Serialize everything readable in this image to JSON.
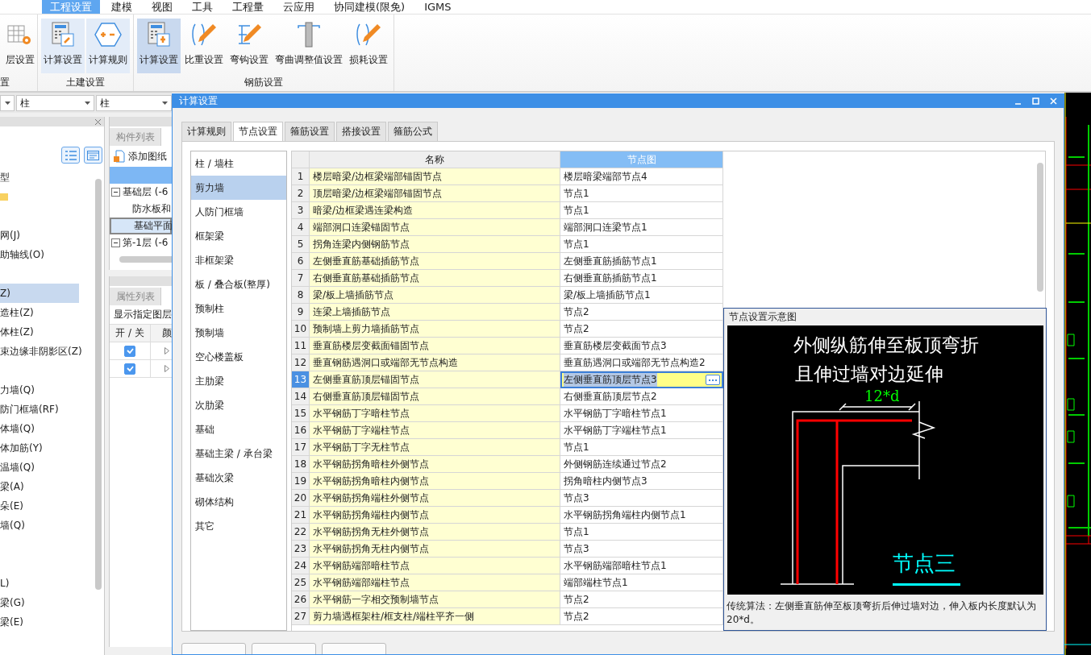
{
  "menu": [
    {
      "label": "工程设置",
      "selected": true
    },
    {
      "label": "建模",
      "selected": false
    },
    {
      "label": "视图",
      "selected": false
    },
    {
      "label": "工具",
      "selected": false
    },
    {
      "label": "工程量",
      "selected": false
    },
    {
      "label": "云应用",
      "selected": false
    },
    {
      "label": "协同建模(限免)",
      "selected": false
    },
    {
      "label": "IGMS",
      "selected": false
    }
  ],
  "ribbon": {
    "groups": [
      {
        "label": "置",
        "buttons": [
          {
            "label": "层设置",
            "selected": false,
            "highlighted": false
          }
        ]
      },
      {
        "label": "土建设置",
        "buttons": [
          {
            "label": "计算设置",
            "selected": false,
            "highlighted": true
          },
          {
            "label": "计算规则",
            "selected": false,
            "highlighted": true
          }
        ]
      },
      {
        "label": "钢筋设置",
        "buttons": [
          {
            "label": "计算设置",
            "selected": true,
            "highlighted": false
          },
          {
            "label": "比重设置",
            "selected": false,
            "highlighted": false
          },
          {
            "label": "弯钩设置",
            "selected": false,
            "highlighted": false
          },
          {
            "label": "弯曲调整值设置",
            "selected": false,
            "highlighted": false
          },
          {
            "label": "损耗设置",
            "selected": false,
            "highlighted": false
          }
        ]
      }
    ]
  },
  "selectors": [
    {
      "value": "柱"
    },
    {
      "value": "柱"
    }
  ],
  "left_panel": {
    "items": [
      {
        "kind": "item",
        "label": "型",
        "selected": false
      },
      {
        "kind": "tag",
        "selected": false
      },
      {
        "kind": "blank",
        "selected": false
      },
      {
        "kind": "item",
        "label": "网(J)",
        "selected": false
      },
      {
        "kind": "item",
        "label": "助轴线(O)",
        "selected": false
      },
      {
        "kind": "blank",
        "selected": false
      },
      {
        "kind": "item",
        "label": "Z)",
        "selected": true
      },
      {
        "kind": "item",
        "label": "造柱(Z)",
        "selected": false
      },
      {
        "kind": "item",
        "label": "体柱(Z)",
        "selected": false
      },
      {
        "kind": "item",
        "label": "束边缘非阴影区(Z)",
        "selected": false
      },
      {
        "kind": "blank",
        "selected": false
      },
      {
        "kind": "item",
        "label": "力墙(Q)",
        "selected": false
      },
      {
        "kind": "item",
        "label": "防门框墙(RF)",
        "selected": false
      },
      {
        "kind": "item",
        "label": "体墙(Q)",
        "selected": false
      },
      {
        "kind": "item",
        "label": "体加筋(Y)",
        "selected": false
      },
      {
        "kind": "item",
        "label": "温墙(Q)",
        "selected": false
      },
      {
        "kind": "item",
        "label": "梁(A)",
        "selected": false
      },
      {
        "kind": "item",
        "label": "朵(E)",
        "selected": false
      },
      {
        "kind": "item",
        "label": "墙(Q)",
        "selected": false
      },
      {
        "kind": "blank",
        "selected": false
      },
      {
        "kind": "blank",
        "selected": false
      },
      {
        "kind": "item",
        "label": "L)",
        "selected": false
      },
      {
        "kind": "item",
        "label": "梁(G)",
        "selected": false
      },
      {
        "kind": "item",
        "label": "梁(E)",
        "selected": false
      }
    ]
  },
  "component_panel": {
    "tab": "构件列表",
    "action": "添加图纸",
    "tree": [
      {
        "label": "基础层 (-6",
        "expanded": true,
        "selected": false,
        "children": [
          {
            "label": "防水板和",
            "selected": false
          },
          {
            "label": "基础平面",
            "selected": true
          }
        ]
      },
      {
        "label": "第-1层 (-6",
        "expanded": true,
        "selected": false
      }
    ]
  },
  "property_panel": {
    "tab": "属性列表",
    "filter": "显示指定图层",
    "columns": [
      "开 / 关",
      "颜"
    ],
    "rows": [
      {
        "checked": true
      },
      {
        "checked": true
      }
    ]
  },
  "dialog": {
    "title": "计算设置",
    "tabs": [
      {
        "label": "计算规则",
        "selected": false
      },
      {
        "label": "节点设置",
        "selected": true
      },
      {
        "label": "箍筋设置",
        "selected": false
      },
      {
        "label": "搭接设置",
        "selected": false
      },
      {
        "label": "箍筋公式",
        "selected": false
      }
    ],
    "categories": [
      {
        "label": "柱 / 墙柱",
        "selected": false
      },
      {
        "label": "剪力墙",
        "selected": true
      },
      {
        "label": "人防门框墙",
        "selected": false
      },
      {
        "label": "框架梁",
        "selected": false
      },
      {
        "label": "非框架梁",
        "selected": false
      },
      {
        "label": "板 / 叠合板(整厚)",
        "selected": false
      },
      {
        "label": "预制柱",
        "selected": false
      },
      {
        "label": "预制墙",
        "selected": false
      },
      {
        "label": "空心楼盖板",
        "selected": false
      },
      {
        "label": "主肋梁",
        "selected": false
      },
      {
        "label": "次肋梁",
        "selected": false
      },
      {
        "label": "基础",
        "selected": false
      },
      {
        "label": "基础主梁 / 承台梁",
        "selected": false
      },
      {
        "label": "基础次梁",
        "selected": false
      },
      {
        "label": "砌体结构",
        "selected": false
      },
      {
        "label": "其它",
        "selected": false
      }
    ],
    "table": {
      "columns": [
        {
          "label": "名称",
          "selected": false
        },
        {
          "label": "节点图",
          "selected": true
        }
      ],
      "rows": [
        {
          "index": "1",
          "name": "楼层暗梁/边框梁端部锚固节点",
          "node": "楼层暗梁端部节点4",
          "selected": false
        },
        {
          "index": "2",
          "name": "顶层暗梁/边框梁端部锚固节点",
          "node": "节点1",
          "selected": false
        },
        {
          "index": "3",
          "name": "暗梁/边框梁遇连梁构造",
          "node": "节点1",
          "selected": false
        },
        {
          "index": "4",
          "name": "端部洞口连梁锚固节点",
          "node": "端部洞口连梁节点1",
          "selected": false
        },
        {
          "index": "5",
          "name": "拐角连梁内侧钢筋节点",
          "node": "节点1",
          "selected": false
        },
        {
          "index": "6",
          "name": "左侧垂直筋基础插筋节点",
          "node": "左侧垂直筋插筋节点1",
          "selected": false
        },
        {
          "index": "7",
          "name": "右侧垂直筋基础插筋节点",
          "node": "右侧垂直筋插筋节点1",
          "selected": false
        },
        {
          "index": "8",
          "name": "梁/板上墙插筋节点",
          "node": "梁/板上墙插筋节点1",
          "selected": false
        },
        {
          "index": "9",
          "name": "连梁上墙插筋节点",
          "node": "节点2",
          "selected": false
        },
        {
          "index": "10",
          "name": "预制墙上剪力墙插筋节点",
          "node": "节点2",
          "selected": false
        },
        {
          "index": "11",
          "name": "垂直筋楼层变截面锚固节点",
          "node": "垂直筋楼层变截面节点3",
          "selected": false
        },
        {
          "index": "12",
          "name": "垂直钢筋遇洞口或端部无节点构造",
          "node": "垂直筋遇洞口或端部无节点构造2",
          "selected": false
        },
        {
          "index": "13",
          "name": "左侧垂直筋顶层锚固节点",
          "node": "左侧垂直筋顶层节点3",
          "selected": true
        },
        {
          "index": "14",
          "name": "右侧垂直筋顶层锚固节点",
          "node": "右侧垂直筋顶层节点2",
          "selected": false
        },
        {
          "index": "15",
          "name": "水平钢筋丁字暗柱节点",
          "node": "水平钢筋丁字暗柱节点1",
          "selected": false
        },
        {
          "index": "16",
          "name": "水平钢筋丁字端柱节点",
          "node": "水平钢筋丁字端柱节点1",
          "selected": false
        },
        {
          "index": "17",
          "name": "水平钢筋丁字无柱节点",
          "node": "节点1",
          "selected": false
        },
        {
          "index": "18",
          "name": "水平钢筋拐角暗柱外侧节点",
          "node": "外侧钢筋连续通过节点2",
          "selected": false
        },
        {
          "index": "19",
          "name": "水平钢筋拐角暗柱内侧节点",
          "node": "拐角暗柱内侧节点3",
          "selected": false
        },
        {
          "index": "20",
          "name": "水平钢筋拐角端柱外侧节点",
          "node": "节点3",
          "selected": false
        },
        {
          "index": "21",
          "name": "水平钢筋拐角端柱内侧节点",
          "node": "水平钢筋拐角端柱内侧节点1",
          "selected": false
        },
        {
          "index": "22",
          "name": "水平钢筋拐角无柱外侧节点",
          "node": "节点1",
          "selected": false
        },
        {
          "index": "23",
          "name": "水平钢筋拐角无柱内侧节点",
          "node": "节点3",
          "selected": false
        },
        {
          "index": "24",
          "name": "水平钢筋端部暗柱节点",
          "node": "水平钢筋端部暗柱节点1",
          "selected": false
        },
        {
          "index": "25",
          "name": "水平钢筋端部端柱节点",
          "node": "端部端柱节点1",
          "selected": false
        },
        {
          "index": "26",
          "name": "水平钢筋一字相交预制墙节点",
          "node": "节点2",
          "selected": false
        },
        {
          "index": "27",
          "name": "剪力墙遇框架柱/框支柱/端柱平齐一侧",
          "node": "节点2",
          "selected": false
        }
      ]
    },
    "preview": {
      "title": "节点设置示意图",
      "diagram_lines": [
        "外侧纵筋伸至板顶弯折",
        "且伸过墙对边延伸"
      ],
      "dimension": "12*d",
      "caption": "节点三",
      "description": "传统算法：左侧垂直筋伸至板顶弯折后伸过墙对边，伸入板内长度默认为20*d。"
    }
  }
}
